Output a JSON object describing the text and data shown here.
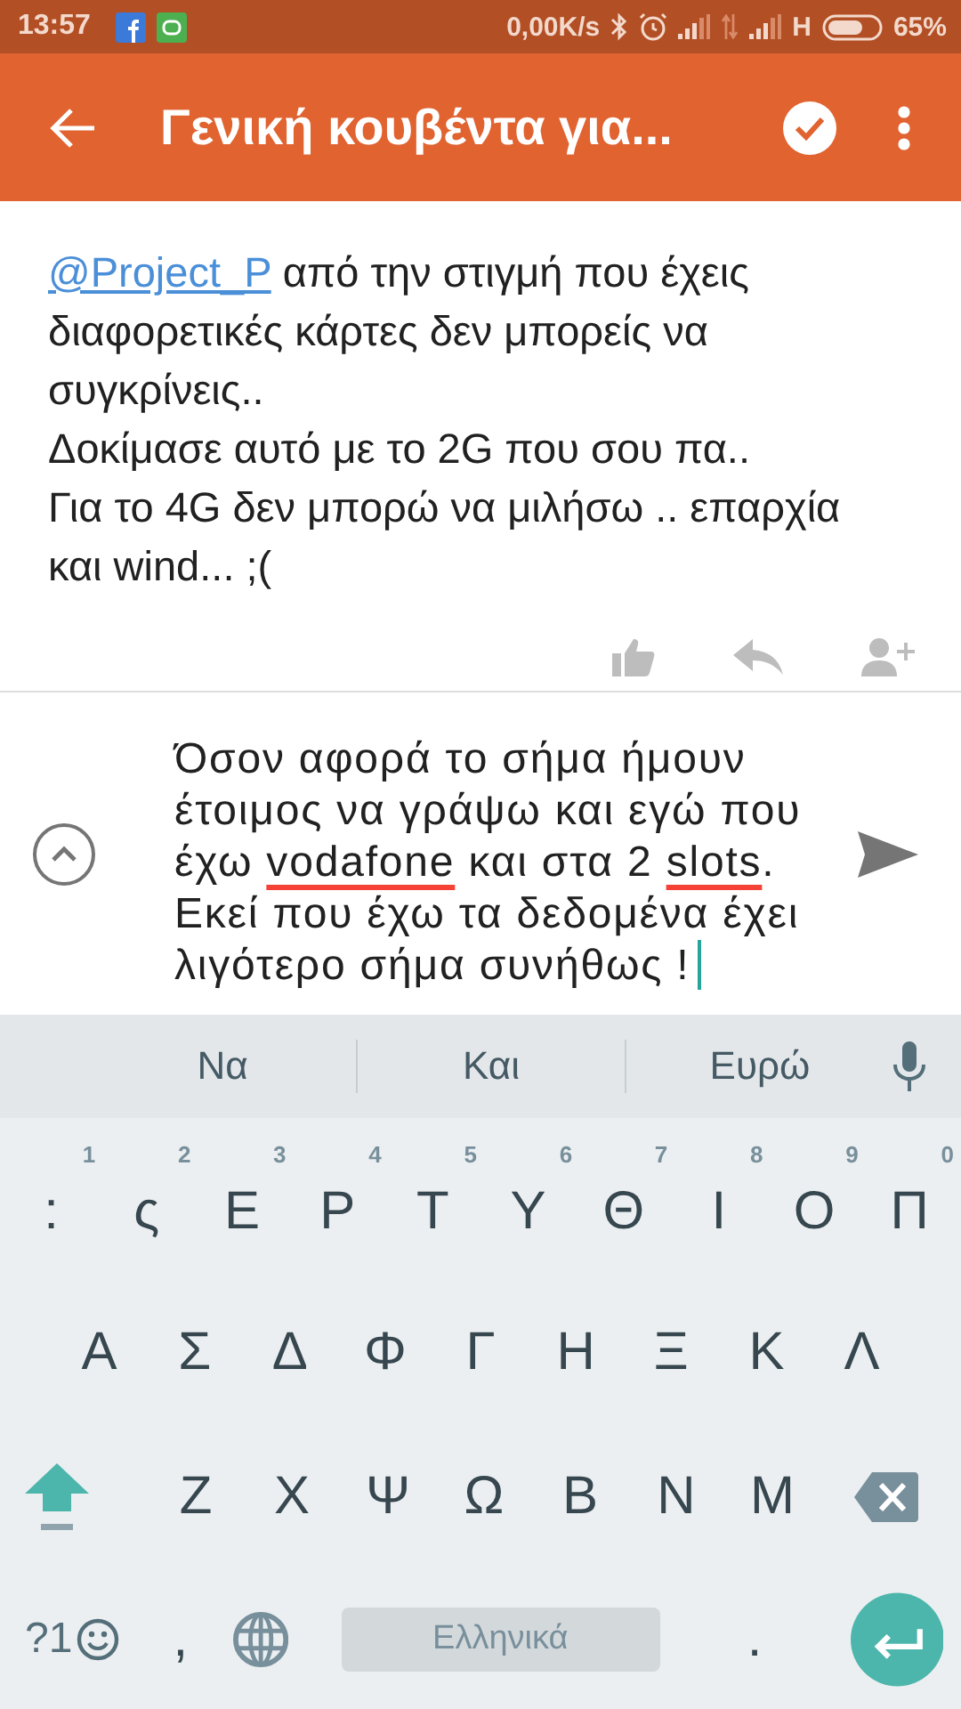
{
  "status_bar": {
    "time": "13:57",
    "speed": "0,00K/s",
    "network": "H",
    "battery": "65%"
  },
  "app_bar": {
    "title": "Γενική κουβέντα για..."
  },
  "message": {
    "mention": "@Project_P",
    "text": " από την στιγμή που έχεις διαφορετικές κάρτες δεν μπορείς να συγκρίνεις..\nΔοκίμασε αυτό με το 2G που σου πα..\nΓια το 4G δεν μπορώ να μιλήσω .. επαρχία και wind... ;("
  },
  "composer": {
    "segments": [
      {
        "text": "Όσον αφορά το σήμα ήμουν έτοιμος να γράψω και εγώ που έχω ",
        "misspelled": false
      },
      {
        "text": "vodafone",
        "misspelled": true
      },
      {
        "text": " και στα 2 ",
        "misspelled": false
      },
      {
        "text": "slots",
        "misspelled": true
      },
      {
        "text": ". Εκεί που έχω τα δεδομένα έχει λιγότερο σήμα συνήθως !",
        "misspelled": false
      }
    ]
  },
  "suggestions": [
    "Να",
    "Και",
    "Ευρώ"
  ],
  "keyboard": {
    "top_row": [
      {
        "kind": "letter",
        "label": ":",
        "hint": "1"
      },
      {
        "kind": "letter",
        "label": "ς",
        "hint": "2"
      },
      {
        "kind": "letter",
        "label": "Ε",
        "hint": "3"
      },
      {
        "kind": "letter",
        "label": "Ρ",
        "hint": "4"
      },
      {
        "kind": "letter",
        "label": "Τ",
        "hint": "5"
      },
      {
        "kind": "letter",
        "label": "Υ",
        "hint": "6"
      },
      {
        "kind": "letter",
        "label": "Θ",
        "hint": "7"
      },
      {
        "kind": "letter",
        "label": "Ι",
        "hint": "8"
      },
      {
        "kind": "letter",
        "label": "Ο",
        "hint": "9"
      },
      {
        "kind": "letter",
        "label": "Π",
        "hint": "0"
      }
    ],
    "middle_row": [
      {
        "kind": "letter",
        "label": "Α"
      },
      {
        "kind": "letter",
        "label": "Σ"
      },
      {
        "kind": "letter",
        "label": "Δ"
      },
      {
        "kind": "letter",
        "label": "Φ"
      },
      {
        "kind": "letter",
        "label": "Γ"
      },
      {
        "kind": "letter",
        "label": "Η"
      },
      {
        "kind": "letter",
        "label": "Ξ"
      },
      {
        "kind": "letter",
        "label": "Κ"
      },
      {
        "kind": "letter",
        "label": "Λ"
      }
    ],
    "lower_row": [
      {
        "kind": "shift",
        "active": true
      },
      {
        "kind": "letter",
        "label": "Ζ"
      },
      {
        "kind": "letter",
        "label": "Χ"
      },
      {
        "kind": "letter",
        "label": "Ψ"
      },
      {
        "kind": "letter",
        "label": "Ω"
      },
      {
        "kind": "letter",
        "label": "Β"
      },
      {
        "kind": "letter",
        "label": "Ν"
      },
      {
        "kind": "letter",
        "label": "Μ"
      },
      {
        "kind": "backspace"
      }
    ],
    "bottom_row": [
      {
        "kind": "symbols",
        "label": "?1"
      },
      {
        "kind": "letter",
        "label": ","
      },
      {
        "kind": "globe"
      },
      {
        "kind": "space",
        "label": "Ελληνικά"
      },
      {
        "kind": "letter",
        "label": "."
      },
      {
        "kind": "enter"
      }
    ]
  }
}
